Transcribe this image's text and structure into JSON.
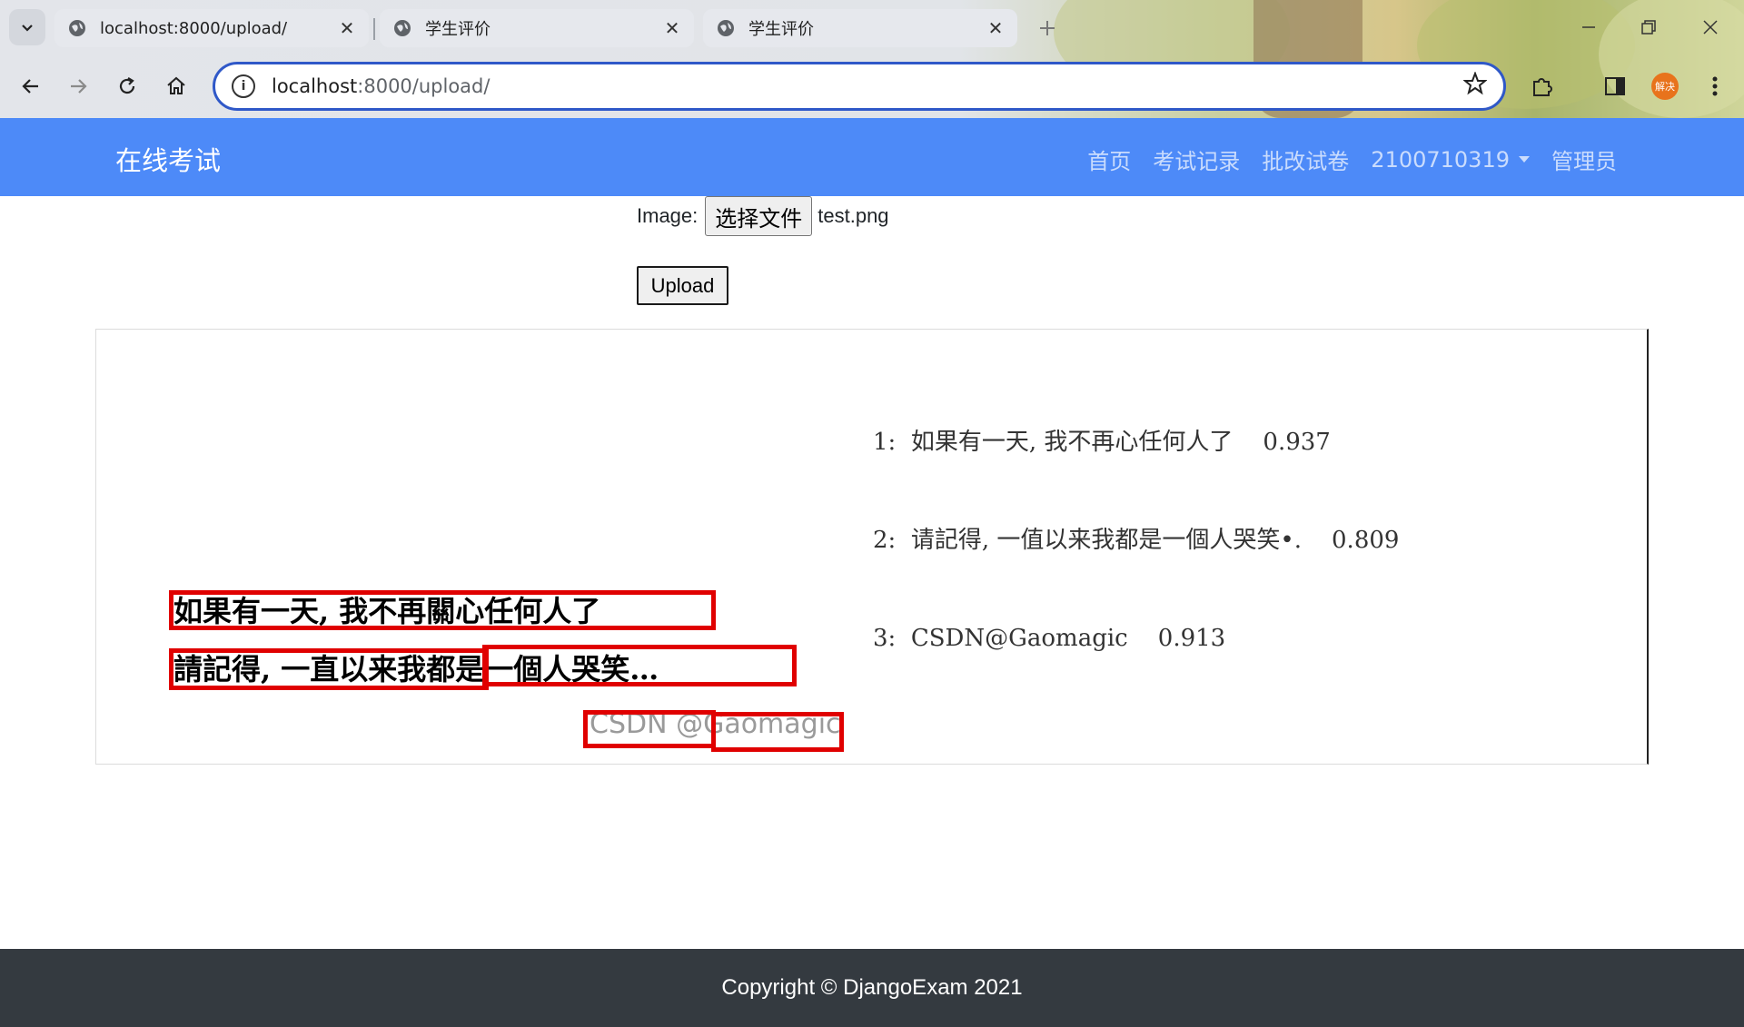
{
  "browser": {
    "tabs": [
      {
        "title": "localhost:8000/upload/",
        "active": false
      },
      {
        "title": "学生评价",
        "active": false
      },
      {
        "title": "学生评价",
        "active": true
      }
    ],
    "url_host": "localhost",
    "url_path": ":8000/upload/",
    "profile_label": "解决"
  },
  "navbar": {
    "brand": "在线考试",
    "links": [
      "首页",
      "考试记录",
      "批改试卷"
    ],
    "user_dropdown": "2100710319",
    "admin_link": "管理员"
  },
  "form": {
    "image_label": "Image:",
    "choose_file_label": "选择文件",
    "file_name": "test.png",
    "upload_label": "Upload"
  },
  "result": {
    "ocr_lines": [
      "1:  如果有一天, 我不再心任何人了    0.937",
      "2:  请記得, 一值以来我都是一個人哭笑•.    0.809",
      "3:  CSDN@Gaomagic    0.913"
    ],
    "image_text": [
      "如果有一天, 我不再關心任何人了",
      "請記得, 一直以来我都是一個人哭笑…",
      "CSDN @Gaomagic"
    ]
  },
  "footer": {
    "copyright": "Copyright © DjangoExam 2021"
  },
  "colors": {
    "navbar": "#4d8af8",
    "footer": "#343a40",
    "box": "#e00000",
    "omnibox_border": "#2f58c8"
  }
}
